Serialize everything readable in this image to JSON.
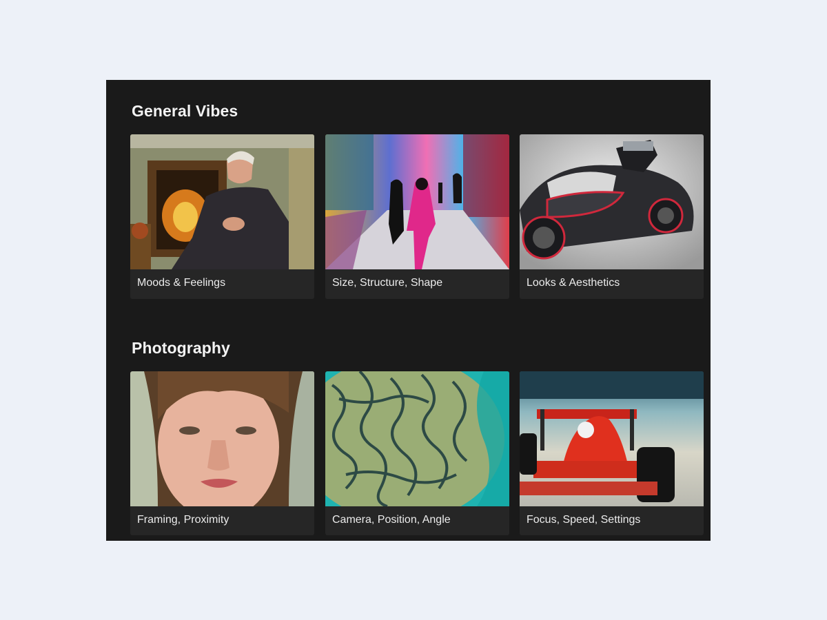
{
  "sections": [
    {
      "title": "General Vibes",
      "cards": [
        {
          "label": "Moods & Feelings",
          "icon": "oil-portrait-image"
        },
        {
          "label": "Size, Structure, Shape",
          "icon": "neon-street-image"
        },
        {
          "label": "Looks & Aesthetics",
          "icon": "concept-car-image"
        }
      ]
    },
    {
      "title": "Photography",
      "cards": [
        {
          "label": "Framing, Proximity",
          "icon": "face-closeup-image"
        },
        {
          "label": "Camera, Position, Angle",
          "icon": "aerial-coral-image"
        },
        {
          "label": "Focus, Speed, Settings",
          "icon": "race-car-image"
        }
      ]
    }
  ],
  "colors": {
    "page_background": "#edf1f8",
    "panel_background": "#1a1a1a",
    "card_background": "#262626",
    "text": "#ececec"
  }
}
